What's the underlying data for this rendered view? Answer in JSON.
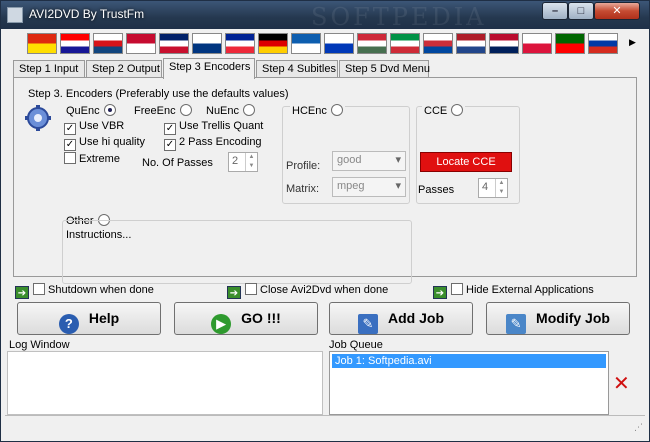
{
  "window": {
    "title": "AVI2DVD By TrustFm",
    "watermark": "SOFTPEDIA"
  },
  "flags": [
    {
      "name": "china",
      "colors": [
        "#de2910",
        "#ffde00"
      ]
    },
    {
      "name": "croatia",
      "colors": [
        "#ff0000",
        "#ffffff",
        "#171796"
      ]
    },
    {
      "name": "czech",
      "colors": [
        "#ffffff",
        "#d7141a",
        "#11457e"
      ]
    },
    {
      "name": "denmark",
      "colors": [
        "#c60c30",
        "#ffffff"
      ]
    },
    {
      "name": "uk",
      "colors": [
        "#012169",
        "#ffffff",
        "#c8102e"
      ]
    },
    {
      "name": "finland",
      "colors": [
        "#ffffff",
        "#003580"
      ]
    },
    {
      "name": "france",
      "colors": [
        "#002395",
        "#ffffff",
        "#ed2939"
      ]
    },
    {
      "name": "germany",
      "colors": [
        "#000000",
        "#dd0000",
        "#ffce00"
      ]
    },
    {
      "name": "greece",
      "colors": [
        "#0d5eaf",
        "#ffffff"
      ]
    },
    {
      "name": "israel",
      "colors": [
        "#ffffff",
        "#0038b8"
      ]
    },
    {
      "name": "hungary",
      "colors": [
        "#ce2939",
        "#ffffff",
        "#477050"
      ]
    },
    {
      "name": "italy",
      "colors": [
        "#009246",
        "#ffffff",
        "#ce2b37"
      ]
    },
    {
      "name": "korea",
      "colors": [
        "#ffffff",
        "#cd2e3a",
        "#0047a0"
      ]
    },
    {
      "name": "netherlands",
      "colors": [
        "#ae1c28",
        "#ffffff",
        "#21468b"
      ]
    },
    {
      "name": "norway",
      "colors": [
        "#ba0c2f",
        "#ffffff",
        "#00205b"
      ]
    },
    {
      "name": "poland",
      "colors": [
        "#ffffff",
        "#dc143c"
      ]
    },
    {
      "name": "portugal",
      "colors": [
        "#006600",
        "#ff0000"
      ]
    },
    {
      "name": "russia",
      "colors": [
        "#ffffff",
        "#0039a6",
        "#d52b1e"
      ]
    }
  ],
  "tabs": [
    "Step 1 Input",
    "Step 2 Output",
    "Step 3 Encoders",
    "Step 4 Subitles",
    "Step 5 Dvd Menu"
  ],
  "active_tab": 2,
  "panel": {
    "heading": "Step 3. Encoders (Preferably use the defaults values)",
    "quenc": "QuEnc",
    "freeenc": "FreeEnc",
    "nuenc": "NuEnc",
    "use_vbr": "Use VBR",
    "use_hi_quality": "Use hi quality",
    "extreme": "Extreme",
    "use_trellis": "Use Trellis Quant",
    "two_pass": "2 Pass Encoding",
    "no_of_passes": "No. Of Passes",
    "passes_value": "2",
    "hcenc": "HCEnc",
    "profile_label": "Profile:",
    "profile_value": "good",
    "matrix_label": "Matrix:",
    "matrix_value": "mpeg",
    "cce": "CCE",
    "locate_cce": "Locate CCE",
    "cce_passes_label": "Passes",
    "cce_passes_value": "4",
    "other": "Other",
    "instructions": "Instructions..."
  },
  "options": {
    "shutdown": "Shutdown when done",
    "close_app": "Close Avi2Dvd when done",
    "hide_ext": "Hide External Applications"
  },
  "buttons": {
    "help": "Help",
    "go": "GO !!!",
    "add_job": "Add Job",
    "modify_job": "Modify Job"
  },
  "log": {
    "label": "Log Window"
  },
  "queue": {
    "label": "Job Queue",
    "items": [
      "Job 1: Softpedia.avi"
    ]
  },
  "colors": {
    "accent_red": "#e01010",
    "selection": "#3399ff",
    "titlebar": "#2a3f5a"
  }
}
